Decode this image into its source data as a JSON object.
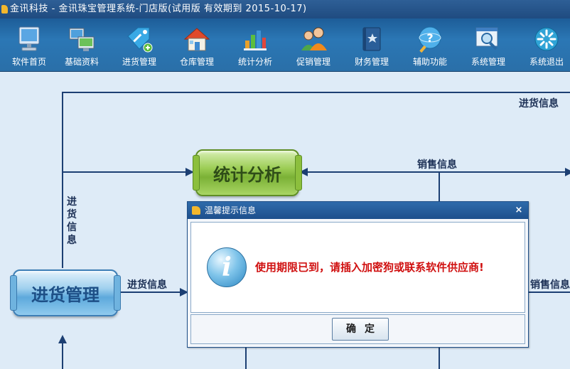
{
  "window": {
    "title": "金讯科技 - 金讯珠宝管理系统-门店版(试用版 有效期到 2015-10-17)"
  },
  "toolbar": {
    "items": [
      {
        "label": "软件首页",
        "icon": "monitor-icon"
      },
      {
        "label": "基础资料",
        "icon": "computers-icon"
      },
      {
        "label": "进货管理",
        "icon": "price-tag-icon"
      },
      {
        "label": "仓库管理",
        "icon": "house-icon"
      },
      {
        "label": "统计分析",
        "icon": "bar-chart-icon"
      },
      {
        "label": "促销管理",
        "icon": "people-icon"
      },
      {
        "label": "财务管理",
        "icon": "ledger-book-icon"
      },
      {
        "label": "辅助功能",
        "icon": "help-globe-icon"
      },
      {
        "label": "系统管理",
        "icon": "magnifier-window-icon"
      },
      {
        "label": "系统退出",
        "icon": "power-icon"
      }
    ]
  },
  "diagram": {
    "nodes": {
      "stats": "统计分析",
      "purchase": "进货管理"
    },
    "labels": {
      "top_right_purchase_info": "进货信息",
      "sales_info_top": "销售信息",
      "vertical_purchase_info": "进货信息",
      "purchase_info_right": "进货信息",
      "sales_info_right": "销售信息"
    }
  },
  "dialog": {
    "title": "温馨提示信息",
    "close": "×",
    "message": "使用期限已到，请插入加密狗或联系软件供应商!",
    "ok_label": "确定",
    "icon": "info-icon"
  },
  "colors": {
    "titlebar": "#1f4b80",
    "toolbar": "#2b77b5",
    "diagram_background": "#deebf7",
    "line": "#1c3f73",
    "message_text": "#d01010"
  }
}
